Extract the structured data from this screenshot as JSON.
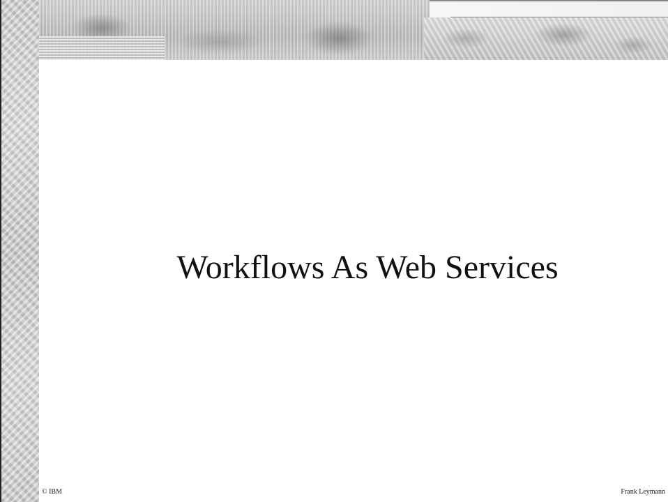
{
  "slide": {
    "title": "Workflows As Web Services",
    "footer_left": "© IBM",
    "footer_right": "Frank Leymann"
  },
  "theme": {
    "background": "#ffffff",
    "text_color": "#111111",
    "banner_style": "grayscale-leaf-texture"
  }
}
